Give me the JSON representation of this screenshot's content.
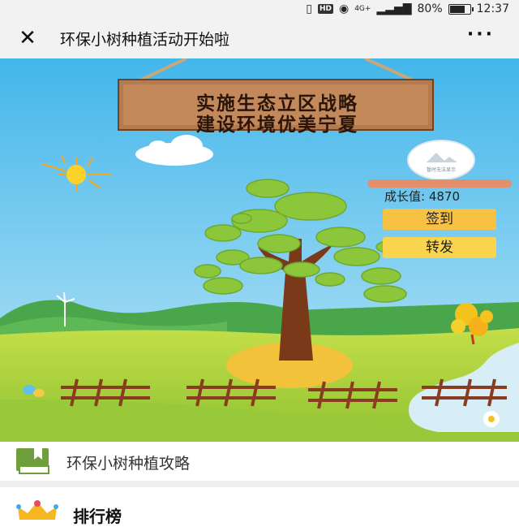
{
  "status_bar": {
    "network": "4G+",
    "battery_percent": "80%",
    "time": "12:37",
    "hd_badge": "HD"
  },
  "nav": {
    "title": "环保小树种植活动开始啦",
    "more_label": "···",
    "close_label": "✕"
  },
  "banner": {
    "sign_line1": "实施生态立区战略",
    "sign_line2": "建设环境优美宁夏"
  },
  "growth": {
    "label": "成长值:  4870",
    "avatar_caption": "暂时无法显示"
  },
  "buttons": {
    "sign_in": "签到",
    "share": "转发"
  },
  "menu": {
    "guide_label": "环保小树种植攻略",
    "leaderboard_label": "排行榜"
  },
  "colors": {
    "button_yellow": "#f7c243",
    "growth_bar": "#e58e6a",
    "sky": "#5cc4ec",
    "grass": "#a9d23c",
    "icon_green": "#6f9e3c"
  }
}
